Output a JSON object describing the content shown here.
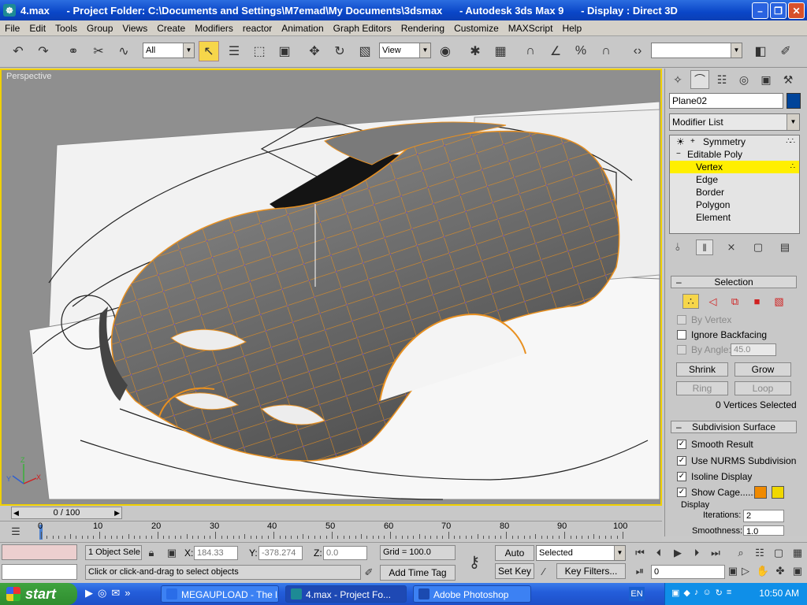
{
  "window": {
    "title": "4.max      - Project Folder: C:\\Documents and Settings\\M7emad\\My Documents\\3dsmax      - Autodesk 3ds Max 9      - Display : Direct 3D",
    "app_icon": "3dsmax-icon"
  },
  "menu": [
    "File",
    "Edit",
    "Tools",
    "Group",
    "Views",
    "Create",
    "Modifiers",
    "reactor",
    "Animation",
    "Graph Editors",
    "Rendering",
    "Customize",
    "MAXScript",
    "Help"
  ],
  "toolbar": {
    "selection_filter": "All",
    "reference_coord": "View",
    "named_selection": ""
  },
  "viewport": {
    "label": "Perspective"
  },
  "command_panel": {
    "object_name": "Plane02",
    "object_color": "#00449a",
    "modifier_list": "Modifier List",
    "stack": [
      {
        "label": "Symmetry",
        "indent": 1,
        "expand": "+",
        "selected": false
      },
      {
        "label": "Editable Poly",
        "indent": 0,
        "expand": "−",
        "selected": false
      },
      {
        "label": "Vertex",
        "indent": 2,
        "expand": "",
        "selected": true
      },
      {
        "label": "Edge",
        "indent": 2,
        "expand": "",
        "selected": false
      },
      {
        "label": "Border",
        "indent": 2,
        "expand": "",
        "selected": false
      },
      {
        "label": "Polygon",
        "indent": 2,
        "expand": "",
        "selected": false
      },
      {
        "label": "Element",
        "indent": 2,
        "expand": "",
        "selected": false
      }
    ],
    "selection": {
      "title": "Selection",
      "by_vertex": "By Vertex",
      "ignore_backfacing": "Ignore Backfacing",
      "by_angle": "By Angle:",
      "angle_value": "45.0",
      "shrink": "Shrink",
      "grow": "Grow",
      "ring": "Ring",
      "loop": "Loop",
      "status": "0 Vertices Selected"
    },
    "subdivision": {
      "title": "Subdivision Surface",
      "smooth_result": "Smooth Result",
      "use_nurms": "Use NURMS Subdivision",
      "isoline": "Isoline Display",
      "show_cage": "Show Cage......",
      "cage_color_1": "#f08a00",
      "cage_color_2": "#f0d800",
      "display": "Display",
      "iterations_label": "Iterations:",
      "iterations_value": "2",
      "smoothness_label": "Smoothness:",
      "smoothness_value": "1.0"
    }
  },
  "timeline": {
    "frame": "0 / 100",
    "ticks": [
      "0",
      "10",
      "20",
      "30",
      "40",
      "50",
      "60",
      "70",
      "80",
      "90",
      "100"
    ]
  },
  "status": {
    "selection_count": "1 Object Sele",
    "x_label": "X:",
    "x_value": "184.33",
    "y_label": "Y:",
    "y_value": "-378.274",
    "z_label": "Z:",
    "z_value": "0.0",
    "grid": "Grid = 100.0",
    "prompt": "Click or click-and-drag to select objects",
    "add_time_tag": "Add Time Tag",
    "auto_key": "Auto Key",
    "set_key": "Set Key",
    "key_mode": "Selected",
    "key_filters": "Key Filters...",
    "current_frame": "0"
  },
  "taskbar": {
    "start": "start",
    "tasks": [
      {
        "label": "MEGAUPLOAD - The l...",
        "active": false,
        "color": "#2a6de8"
      },
      {
        "label": "4.max     - Project Fo...",
        "active": true,
        "color": "#1d8a95"
      },
      {
        "label": "Adobe Photoshop",
        "active": false,
        "color": "#1b4ab0"
      }
    ],
    "language": "EN",
    "clock": "10:50 AM"
  }
}
